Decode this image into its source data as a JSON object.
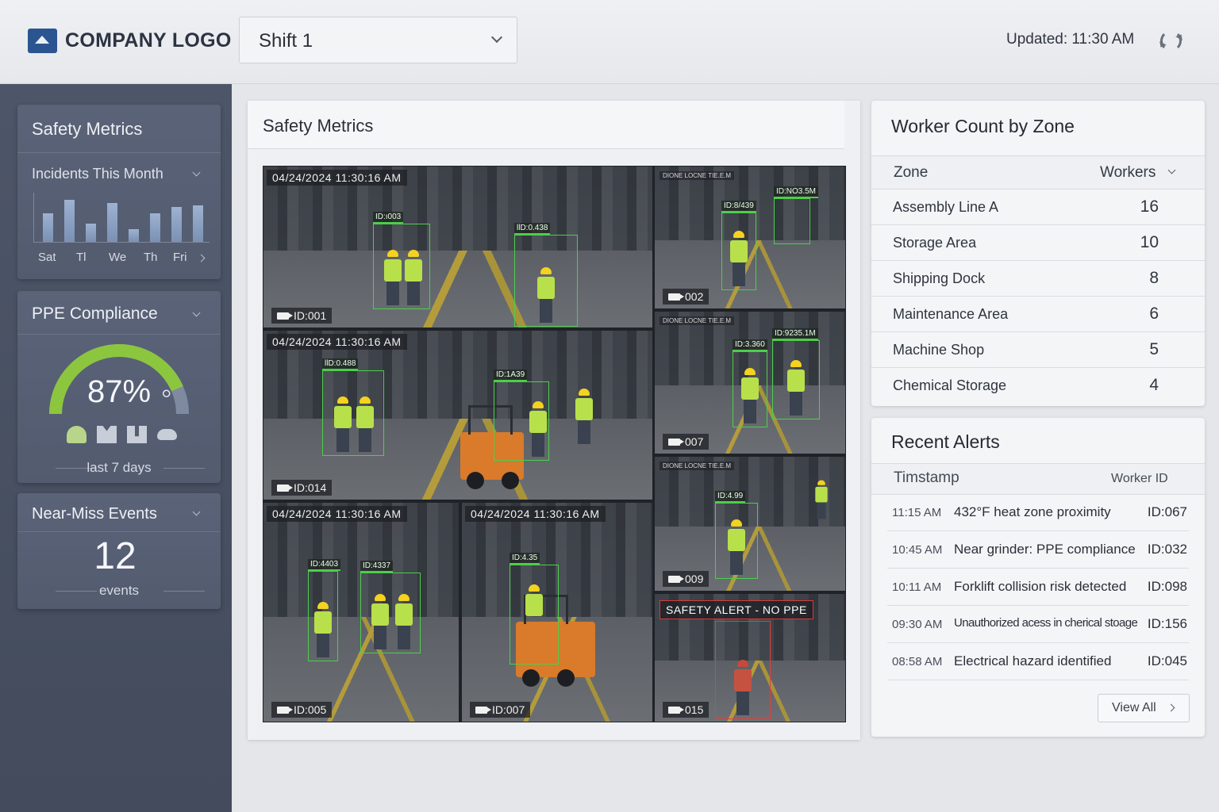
{
  "header": {
    "logo_text": "COMPANY LOGO",
    "shift_value": "Shift 1",
    "updated_text": "Updated: 11:30 AM"
  },
  "sidebar": {
    "title": "Safety Metrics",
    "incidents": {
      "title": "Incidents This Month",
      "days": [
        "Sat",
        "Tl",
        "We",
        "Th",
        "Fri"
      ],
      "bar_values": [
        34,
        50,
        22,
        46,
        15,
        34,
        42,
        44
      ]
    },
    "ppe": {
      "title": "PPE Compliance",
      "value": 87,
      "value_text": "87%",
      "caption": "last 7 days",
      "icons": [
        "helmet-icon",
        "vest-icon",
        "boots-icon",
        "glasses-icon"
      ]
    },
    "near_miss": {
      "title": "Near-Miss Events",
      "value": "12",
      "unit": "events"
    }
  },
  "center": {
    "title": "Safety Metrics",
    "cameras": [
      {
        "timestamp": "04/24/2024 11:30:16 AM",
        "cam_id": "ID:001",
        "detections": [
          "ID:ı003",
          "llD:0.438"
        ]
      },
      {
        "timestamp": "DIONE LOCNE TIE.E.M",
        "cam_id": "002",
        "detections": [
          "ID:8/439",
          "ID:NO3.5M"
        ]
      },
      {
        "timestamp": "DIONE LOCNE TIE.E.M",
        "cam_id": "007",
        "detections": [
          "ID:3.360",
          "ID:9235.1M"
        ]
      },
      {
        "timestamp": "04/24/2024 11:30:16 AM",
        "cam_id": "ID:014",
        "detections": [
          "llD:0.488",
          "ID:1A39"
        ]
      },
      {
        "timestamp": "DIONE LOCNE TIE.E.M",
        "cam_id": "009",
        "detections": [
          "ID:4.99"
        ]
      },
      {
        "timestamp": "04/24/2024 11:30:16 AM",
        "cam_id": "ID:005",
        "detections": [
          "ID:4403",
          "ID:4337"
        ]
      },
      {
        "timestamp": "04/24/2024 11:30:16 AM",
        "cam_id": "ID:007",
        "detections": [
          "ID:4.35"
        ]
      },
      {
        "alert": "SAFETY ALERT  -  NO PPE",
        "cam_id": "015"
      }
    ]
  },
  "zones": {
    "title": "Worker Count by Zone",
    "col_zone": "Zone",
    "col_workers": "Workers",
    "rows": [
      {
        "zone": "Assembly Line A",
        "workers": "16"
      },
      {
        "zone": "Storage Area",
        "workers": "10"
      },
      {
        "zone": "Shipping Dock",
        "workers": "8"
      },
      {
        "zone": "Maintenance Area",
        "workers": "6"
      },
      {
        "zone": "Machine Shop",
        "workers": "5"
      },
      {
        "zone": "Chemical Storage",
        "workers": "4"
      }
    ]
  },
  "alerts": {
    "title": "Recent Alerts",
    "col_time": "Timstamp",
    "col_worker": "Worker  ID",
    "rows": [
      {
        "time": "11:15 AM",
        "message": "432°F heat zone proximity",
        "worker": "ID:067"
      },
      {
        "time": "10:45 AM",
        "message": "Near grinder: PPE compliance",
        "worker": "ID:032"
      },
      {
        "time": "10:11 AM",
        "message": "Forklift collision risk detected",
        "worker": "ID:098"
      },
      {
        "time": "09:30 AM",
        "message": "Unauthorized acess in cherical stoage",
        "worker": "ID:156"
      },
      {
        "time": "08:58 AM",
        "message": "Electrical hazard identified",
        "worker": "ID:045"
      }
    ],
    "view_all": "View All"
  },
  "colors": {
    "accent": "#2b5591",
    "gauge_fill": "#8cc63f",
    "detection_box": "#4ccf4a",
    "alert_box": "#e04040"
  }
}
